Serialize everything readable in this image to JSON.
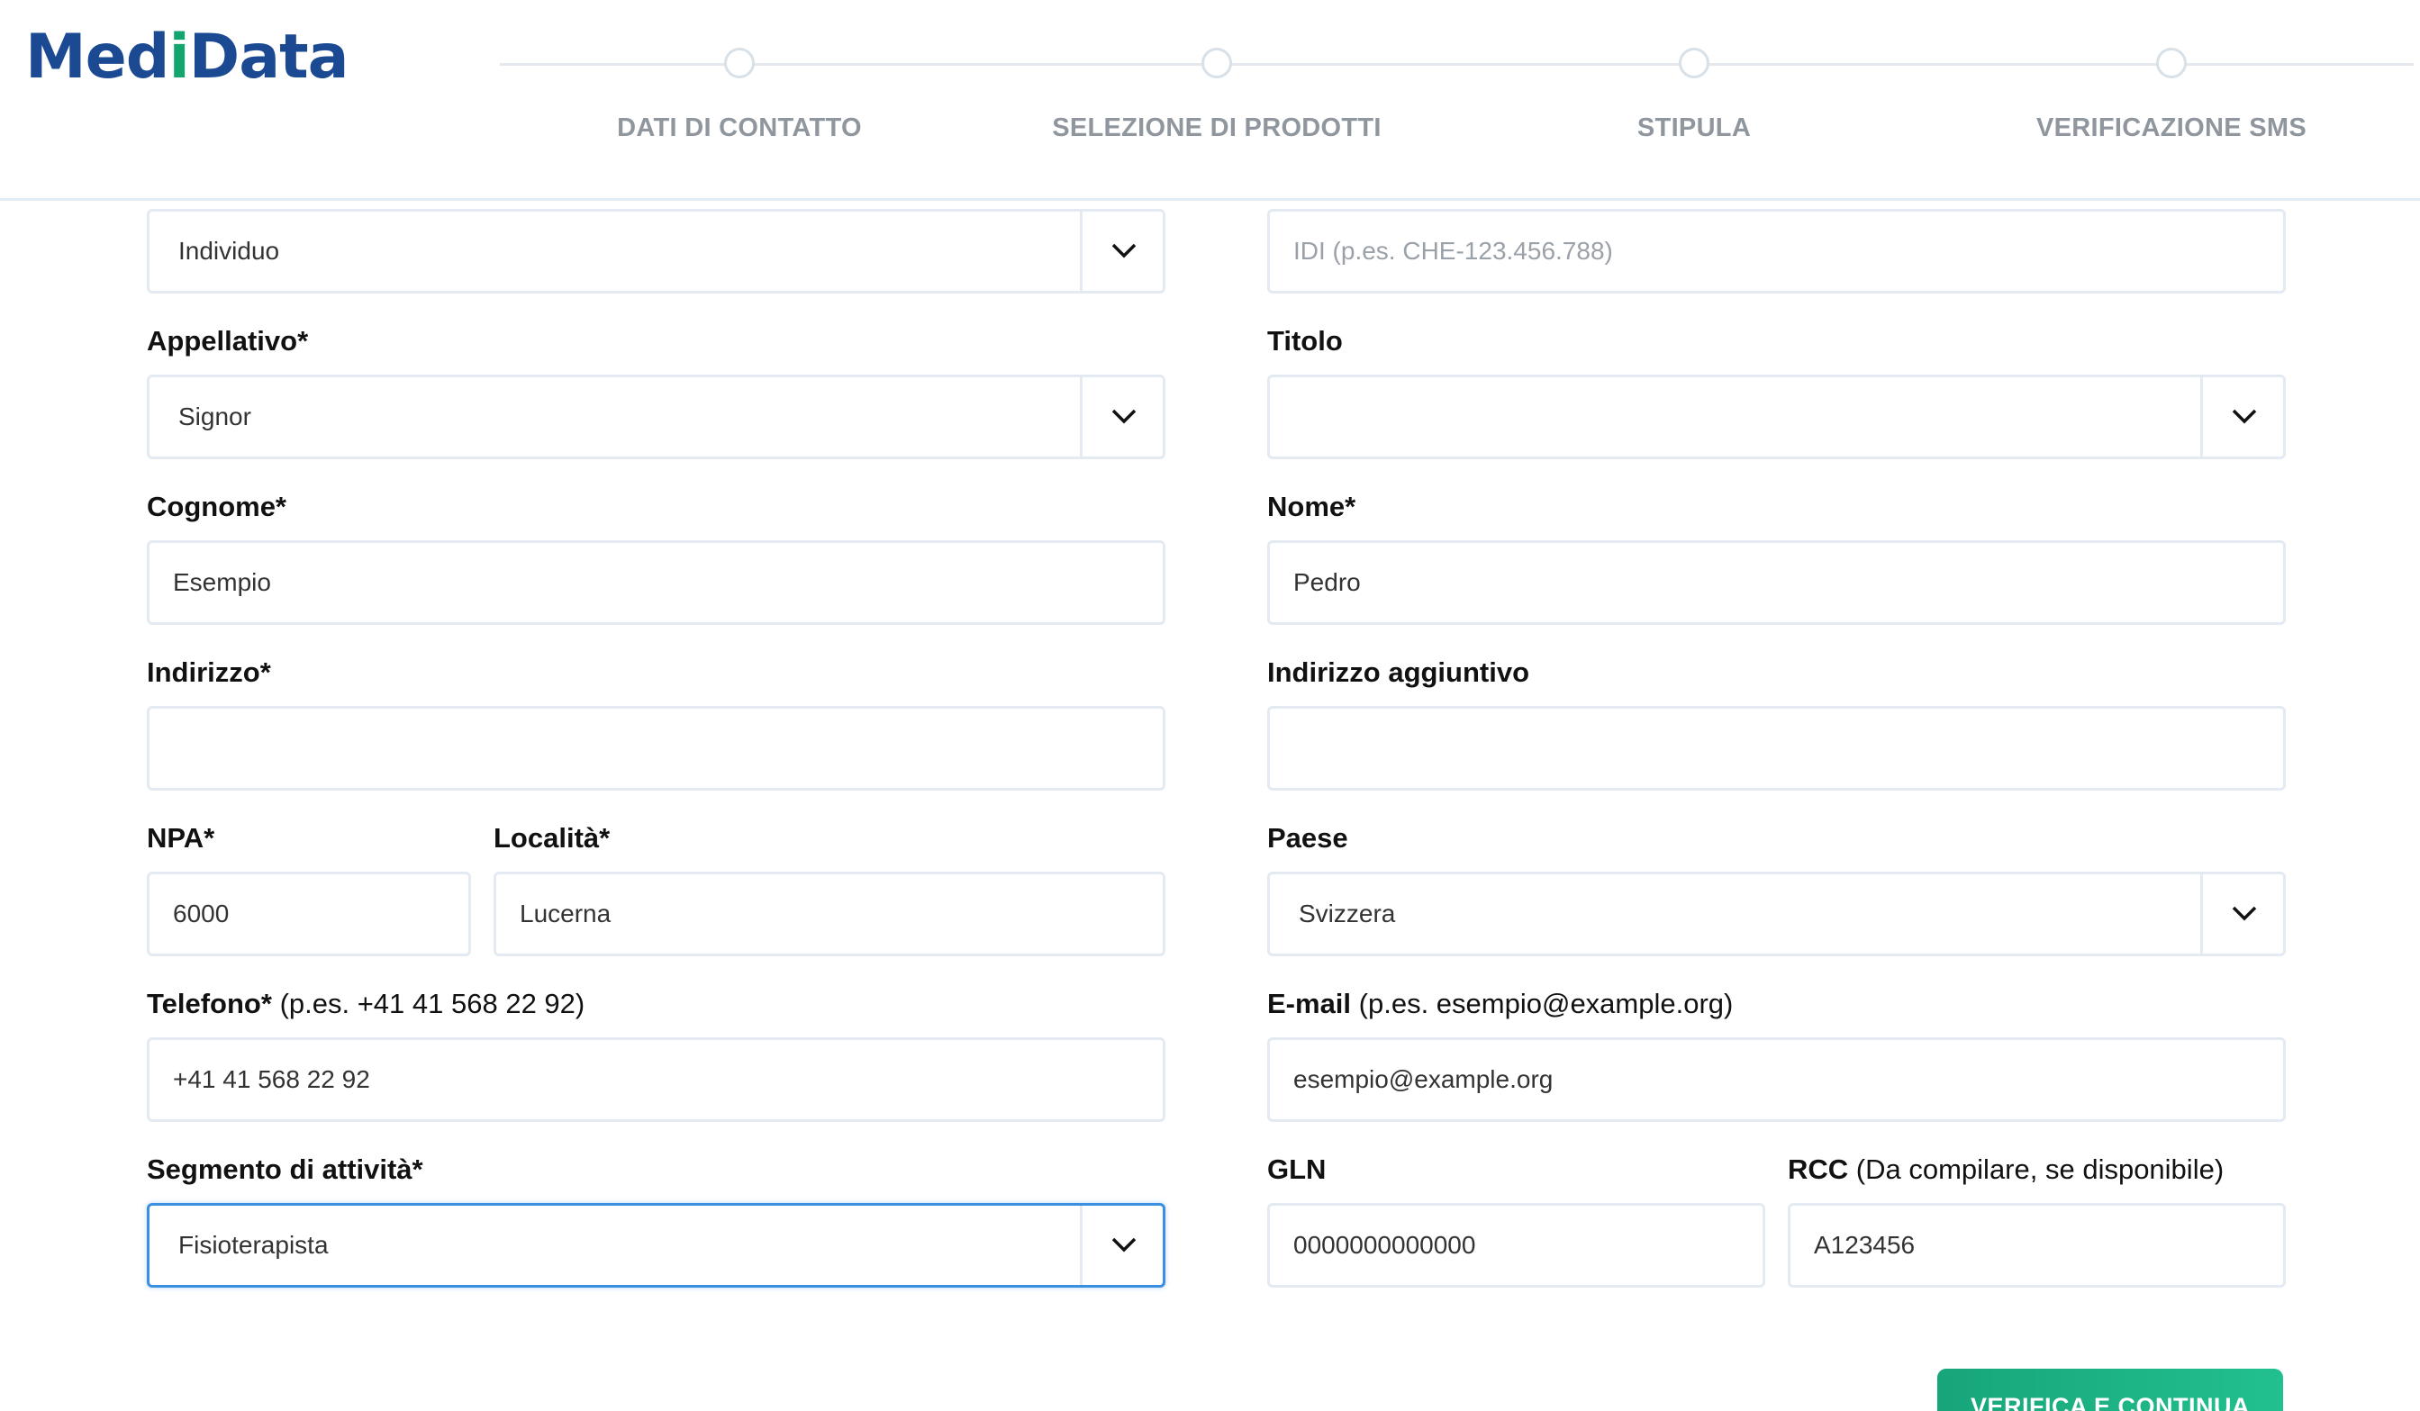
{
  "header": {
    "logo_part1": "Med",
    "logo_i": "i",
    "logo_part2": "Data",
    "steps": [
      {
        "label": "DATI DI CONTATTO"
      },
      {
        "label": "SELEZIONE DI PRODOTTI"
      },
      {
        "label": "STIPULA"
      },
      {
        "label": "VERIFICAZIONE SMS"
      }
    ]
  },
  "form": {
    "entity_type": {
      "value": "Individuo"
    },
    "idi": {
      "placeholder": "IDI (p.es. CHE-123.456.788)",
      "value": ""
    },
    "salutation": {
      "label": "Appellativo*",
      "value": "Signor"
    },
    "title": {
      "label": "Titolo",
      "value": ""
    },
    "surname": {
      "label": "Cognome*",
      "value": "Esempio"
    },
    "first_name": {
      "label": "Nome*",
      "value": "Pedro"
    },
    "address": {
      "label": "Indirizzo*",
      "value": ""
    },
    "address_extra": {
      "label": "Indirizzo aggiuntivo",
      "value": ""
    },
    "zip": {
      "label": "NPA*",
      "value": "6000"
    },
    "city": {
      "label": "Località*",
      "value": "Lucerna"
    },
    "country": {
      "label": "Paese",
      "value": "Svizzera"
    },
    "phone": {
      "label": "Telefono*",
      "hint": "(p.es. +41 41 568 22 92)",
      "value": "+41 41 568 22 92"
    },
    "email": {
      "label": "E-mail",
      "hint": "(p.es. esempio@example.org)",
      "value": "esempio@example.org"
    },
    "segment": {
      "label": "Segmento di attività*",
      "value": "Fisioterapista"
    },
    "gln": {
      "label": "GLN",
      "value": "0000000000000"
    },
    "rcc": {
      "label": "RCC",
      "hint": "(Da compilare, se disponibile)",
      "value": "A123456"
    }
  },
  "actions": {
    "submit_label": "VERIFICA E CONTINUA"
  },
  "colors": {
    "brand_blue": "#1b4a93",
    "brand_green": "#13a56e",
    "focus_blue": "#3a8fe0",
    "button_green": "#1cb484"
  }
}
